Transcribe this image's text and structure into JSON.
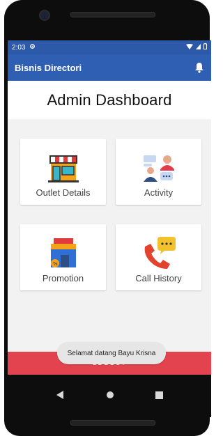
{
  "status_bar": {
    "time": "2:03"
  },
  "app_bar": {
    "title": "Bisnis Directori"
  },
  "header": {
    "title": "Admin Dashboard"
  },
  "menu": [
    {
      "label": "Outlet Details",
      "icon": "store-icon"
    },
    {
      "label": "Activity",
      "icon": "people-chat-icon"
    },
    {
      "label": "Promotion",
      "icon": "promo-shop-icon"
    },
    {
      "label": "Call History",
      "icon": "phone-chat-icon"
    }
  ],
  "logout": {
    "label": "LOGOUT"
  },
  "toast": {
    "message": "Selamat datang Bayu Krisna"
  },
  "colors": {
    "app_bar": "#2f5fb3",
    "logout": "#e2434e",
    "toast": "#e6e6e6"
  }
}
